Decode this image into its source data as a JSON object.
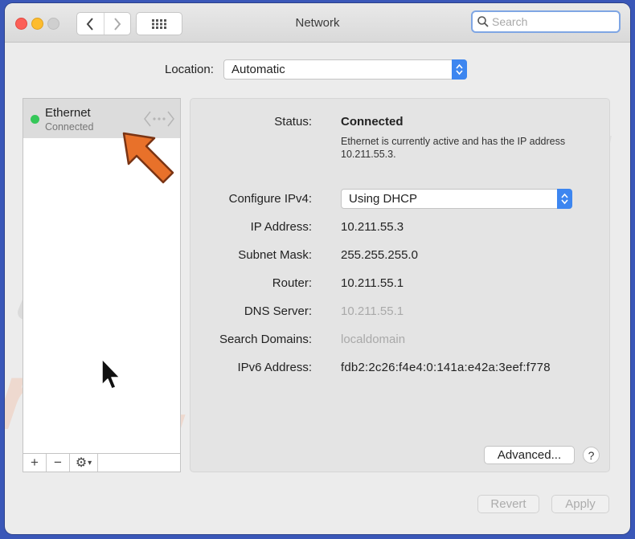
{
  "window": {
    "title": "Network"
  },
  "search": {
    "placeholder": "Search",
    "value": ""
  },
  "location": {
    "label": "Location:",
    "value": "Automatic"
  },
  "services": [
    {
      "name": "Ethernet",
      "status": "Connected",
      "status_color": "#35c759"
    }
  ],
  "sidebar_toolbar": {
    "add": "+",
    "remove": "−",
    "gear": "⚙",
    "gear_caret": "▾"
  },
  "details": {
    "status_label": "Status:",
    "status_value": "Connected",
    "status_desc": "Ethernet is currently active and has the IP address 10.211.55.3.",
    "configure_label": "Configure IPv4:",
    "configure_value": "Using DHCP",
    "ip_label": "IP Address:",
    "ip_value": "10.211.55.3",
    "subnet_label": "Subnet Mask:",
    "subnet_value": "255.255.255.0",
    "router_label": "Router:",
    "router_value": "10.211.55.1",
    "dns_label": "DNS Server:",
    "dns_value": "10.211.55.1",
    "domains_label": "Search Domains:",
    "domains_value": "localdomain",
    "ipv6_label": "IPv6 Address:",
    "ipv6_value": "fdb2:2c26:f4e4:0:141a:e42a:3eef:f778"
  },
  "buttons": {
    "advanced": "Advanced...",
    "help": "?",
    "revert": "Revert",
    "apply": "Apply"
  },
  "watermark": {
    "text": "risk.com"
  },
  "colors": {
    "accent": "#3d86f0",
    "pointer_arrow": "#e8712a",
    "desktop": "#3a57b8"
  }
}
